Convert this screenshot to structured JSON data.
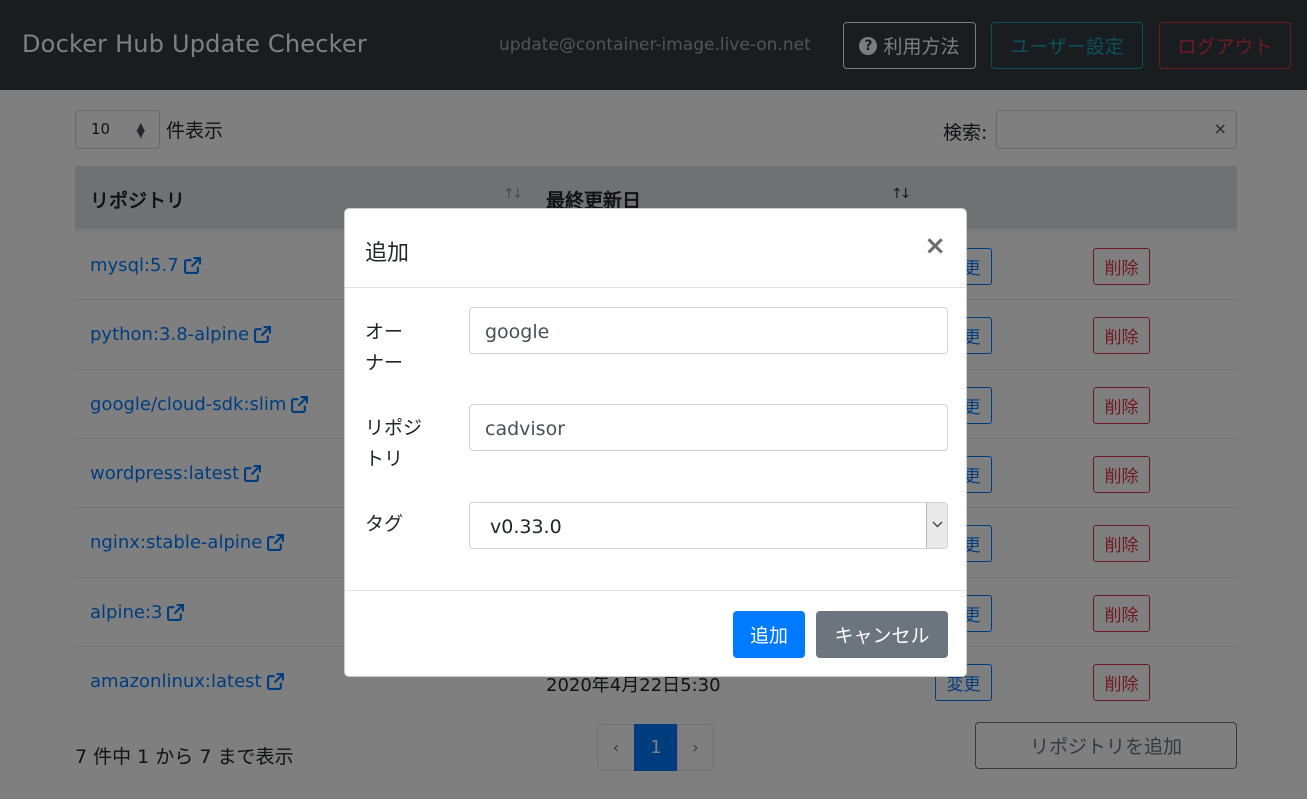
{
  "navbar": {
    "brand": "Docker Hub Update Checker",
    "email": "update@container-image.live-on.net",
    "help_label": "利用方法",
    "user_settings_label": "ユーザー設定",
    "logout_label": "ログアウト"
  },
  "table_controls": {
    "page_length": "10",
    "page_length_label": "件表示",
    "search_label": "検索:",
    "search_value": "",
    "clear_glyph": "×"
  },
  "table": {
    "headers": [
      "リポジトリ",
      "最終更新日"
    ],
    "sort_glyph": "↑↓",
    "edit_label": "変更",
    "delete_label": "削除",
    "rows": [
      {
        "repo": "mysql:5.7",
        "date": ""
      },
      {
        "repo": "python:3.8-alpine",
        "date": ""
      },
      {
        "repo": "google/cloud-sdk:slim",
        "date": ""
      },
      {
        "repo": "wordpress:latest",
        "date": ""
      },
      {
        "repo": "nginx:stable-alpine",
        "date": ""
      },
      {
        "repo": "alpine:3",
        "date": ""
      },
      {
        "repo": "amazonlinux:latest",
        "date": "2020年4月22日5:30"
      }
    ]
  },
  "footer": {
    "info": "7 件中 1 から 7 まで表示",
    "prev": "‹",
    "current_page": "1",
    "next": "›",
    "add_repo_label": "リポジトリを追加"
  },
  "modal": {
    "title": "追加",
    "close_glyph": "×",
    "owner_label_line1": "オー",
    "owner_label_line2": "ナー",
    "owner_value": "google",
    "repo_label_line1": "リポジ",
    "repo_label_line2": "トリ",
    "repo_value": "cadvisor",
    "tag_label": "タグ",
    "tag_selected": "v0.33.0",
    "submit_label": "追加",
    "cancel_label": "キャンセル"
  },
  "colors": {
    "navbar_bg": "#343a40",
    "primary": "#007bff",
    "danger": "#dc3545",
    "info": "#17a2b8",
    "secondary": "#6c757d"
  }
}
